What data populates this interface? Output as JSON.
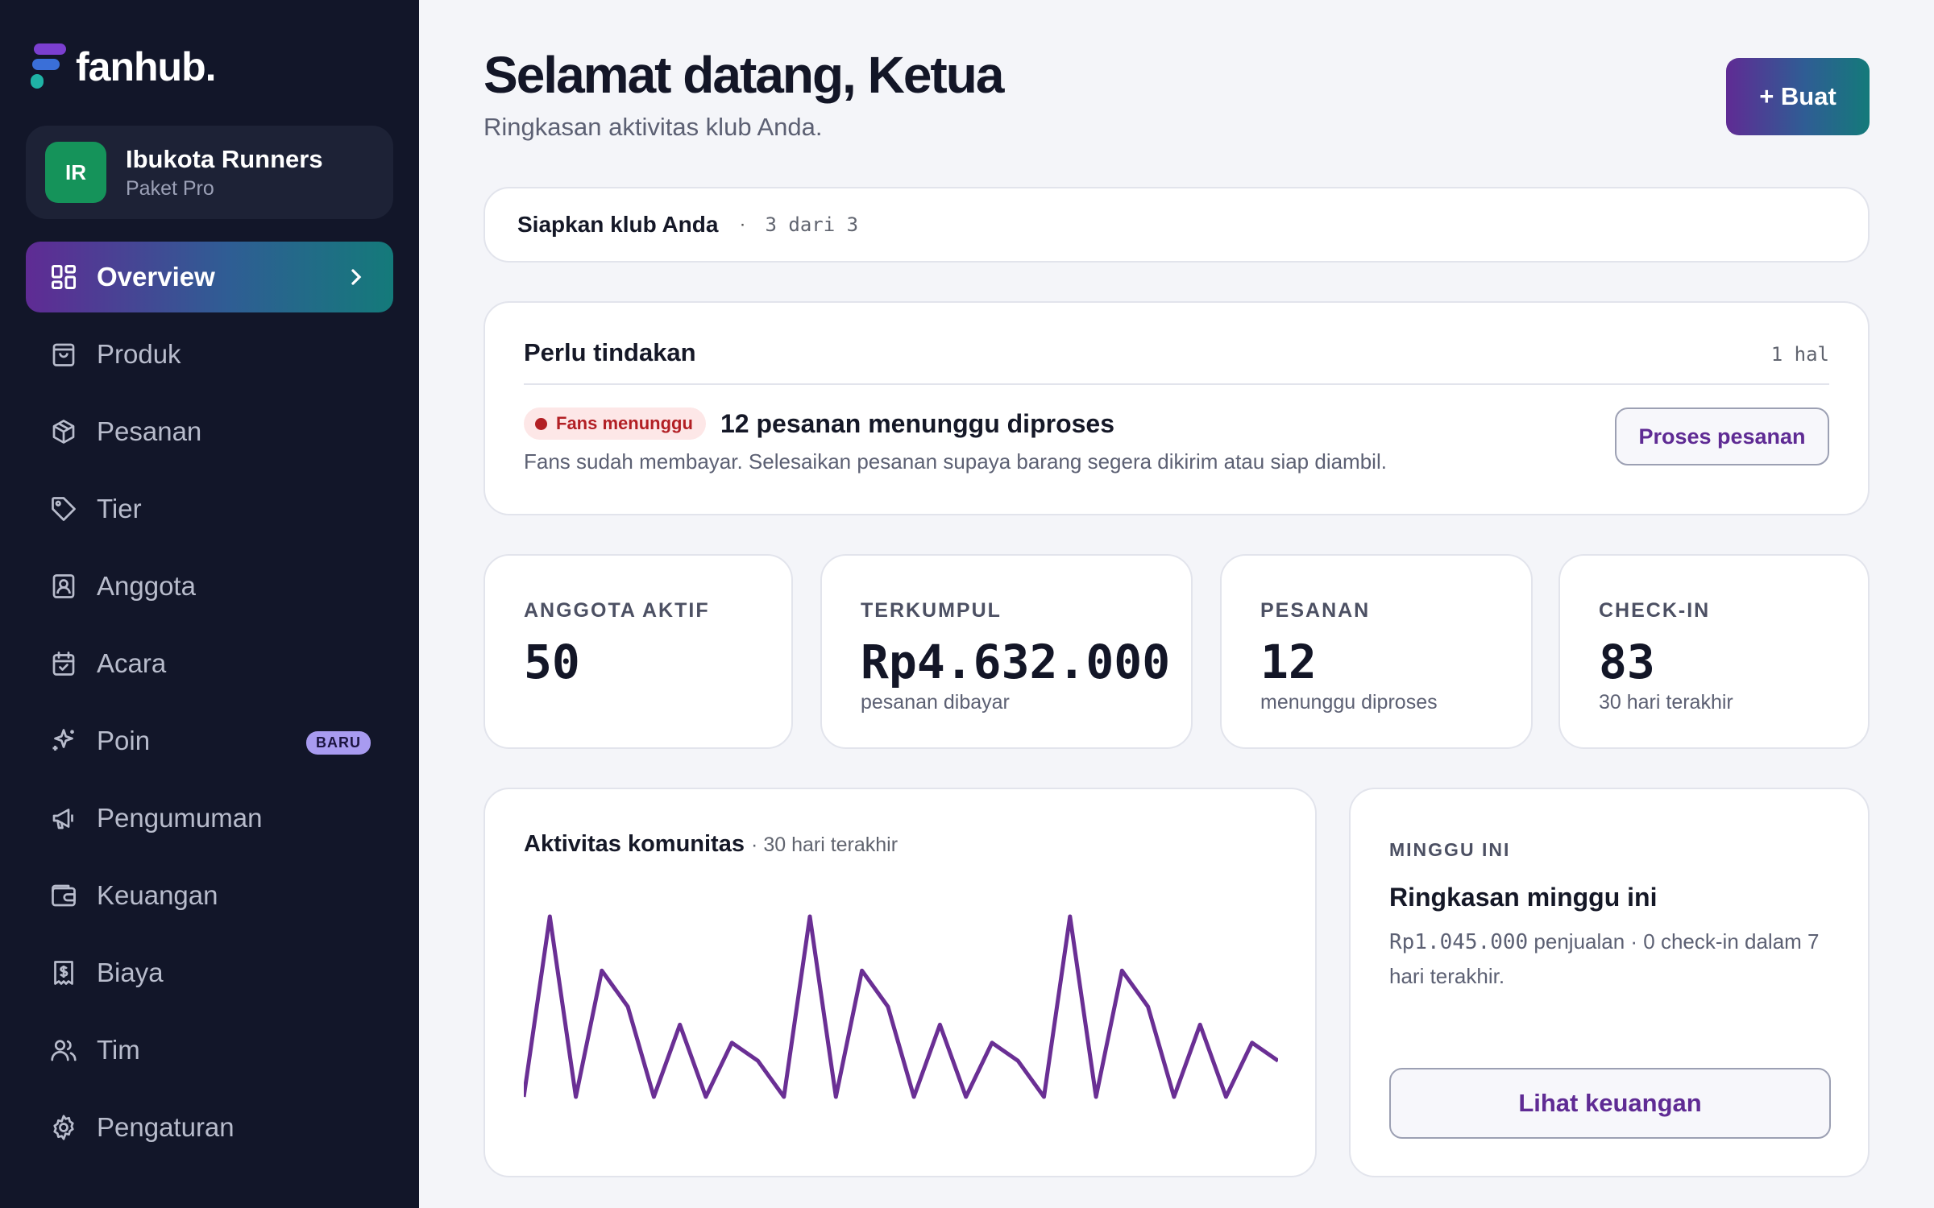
{
  "brand": {
    "name": "fanhub."
  },
  "club": {
    "initials": "IR",
    "name": "Ibukota Runners",
    "plan": "Paket Pro"
  },
  "nav": {
    "overview": "Overview",
    "produk": "Produk",
    "pesanan": "Pesanan",
    "tier": "Tier",
    "anggota": "Anggota",
    "acara": "Acara",
    "poin": "Poin",
    "poin_badge": "BARU",
    "pengumuman": "Pengumuman",
    "keuangan": "Keuangan",
    "biaya": "Biaya",
    "tim": "Tim",
    "pengaturan": "Pengaturan"
  },
  "header": {
    "title": "Selamat datang, Ketua",
    "subtitle": "Ringkasan aktivitas klub Anda.",
    "create_label": "+ Buat"
  },
  "setup": {
    "label": "Siapkan klub Anda",
    "separator": "·",
    "progress": "3 dari 3"
  },
  "action": {
    "title": "Perlu tindakan",
    "count": "1 hal",
    "badge": "Fans menunggu",
    "headline": "12 pesanan menunggu diproses",
    "description": "Fans sudah membayar. Selesaikan pesanan supaya barang segera dikirim atau siap diambil.",
    "button": "Proses pesanan"
  },
  "stats": [
    {
      "label": "ANGGOTA AKTIF",
      "value": "50",
      "sub": ""
    },
    {
      "label": "TERKUMPUL",
      "value": "Rp4.632.000",
      "sub": "pesanan dibayar"
    },
    {
      "label": "PESANAN",
      "value": "12",
      "sub": "menunggu diproses"
    },
    {
      "label": "CHECK-IN",
      "value": "83",
      "sub": "30 hari terakhir"
    }
  ],
  "activity": {
    "title": "Aktivitas komunitas",
    "subtitle": "· 30 hari terakhir"
  },
  "chart_data": {
    "type": "line",
    "x": [
      1,
      2,
      3,
      4,
      5,
      6,
      7,
      8,
      9,
      10,
      11,
      12,
      13,
      14,
      15,
      16,
      17,
      18,
      19,
      20,
      21,
      22,
      23,
      24,
      25,
      26,
      27,
      28,
      29,
      30
    ],
    "values": [
      0,
      10,
      0,
      7,
      5,
      0,
      4,
      0,
      3,
      2,
      0,
      10,
      0,
      7,
      5,
      0,
      4,
      0,
      3,
      2,
      0,
      10,
      0,
      7,
      5,
      0,
      4,
      0,
      3,
      2
    ],
    "color": "#6a2f94"
  },
  "week": {
    "label": "MINGGU INI",
    "title": "Ringkasan minggu ini",
    "amount": "Rp1.045.000",
    "text": " penjualan · 0 check-in dalam 7 hari terakhir.",
    "button": "Lihat keuangan"
  },
  "colors": {
    "sidebar_bg": "#121629",
    "accent_purple": "#5f2b94",
    "accent_teal": "#147a7a",
    "alert_red": "#b21f24"
  }
}
